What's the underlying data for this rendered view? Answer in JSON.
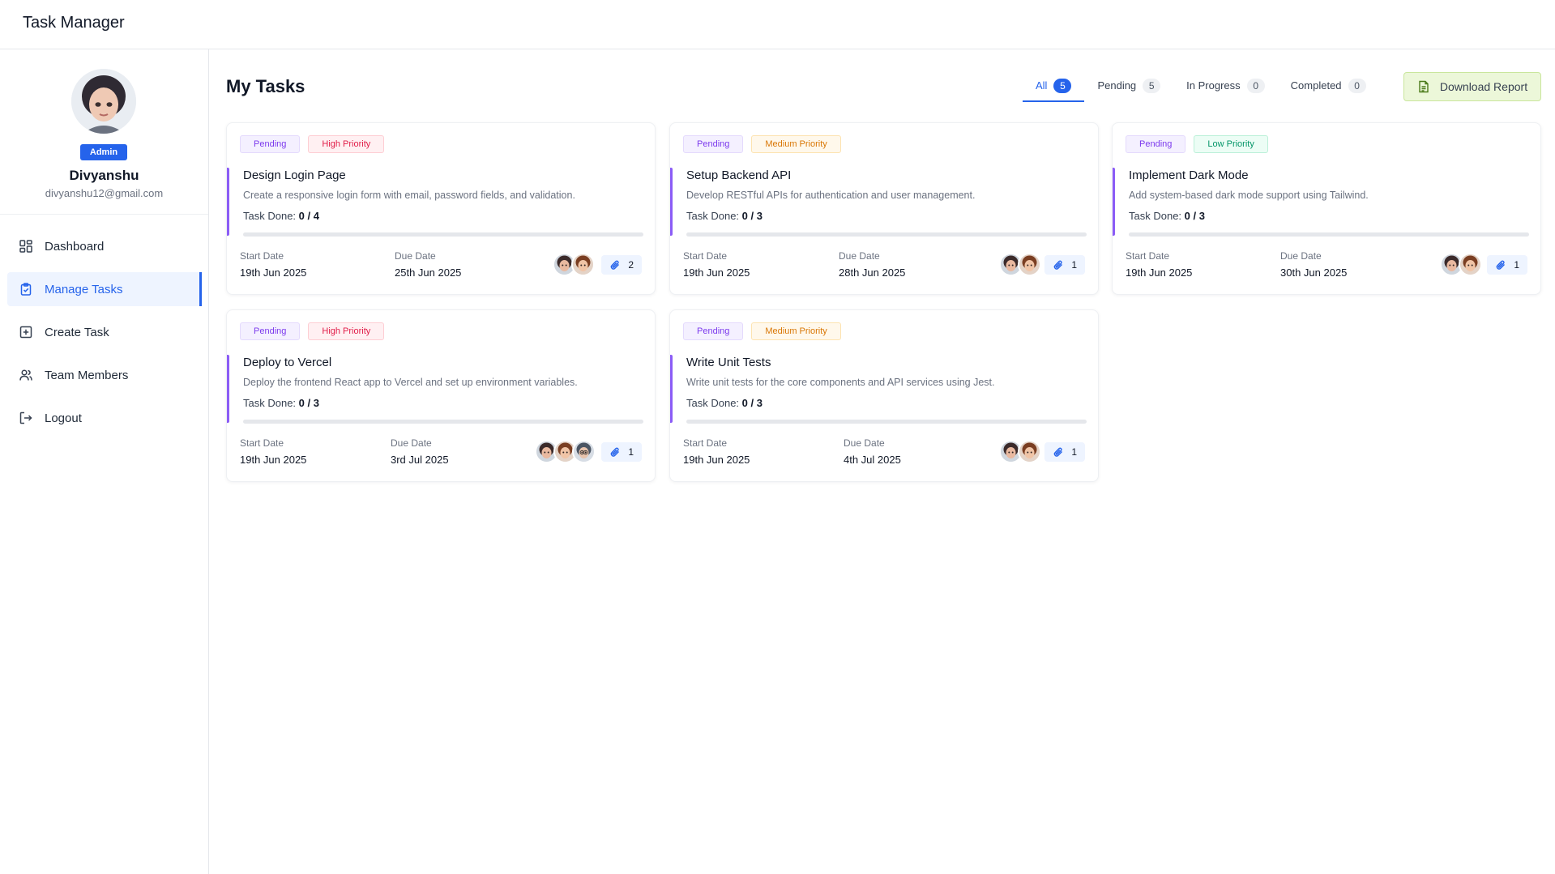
{
  "app": {
    "title": "Task Manager"
  },
  "user": {
    "name": "Divyanshu",
    "email": "divyanshu12@gmail.com",
    "role": "Admin"
  },
  "nav": [
    {
      "label": "Dashboard",
      "icon": "dashboard-icon",
      "active": false
    },
    {
      "label": "Manage Tasks",
      "icon": "clipboard-check-icon",
      "active": true
    },
    {
      "label": "Create Task",
      "icon": "plus-square-icon",
      "active": false
    },
    {
      "label": "Team Members",
      "icon": "users-icon",
      "active": false
    },
    {
      "label": "Logout",
      "icon": "logout-icon",
      "active": false
    }
  ],
  "main": {
    "title": "My Tasks",
    "tabs": [
      {
        "label": "All",
        "count": "5",
        "active": true
      },
      {
        "label": "Pending",
        "count": "5",
        "active": false
      },
      {
        "label": "In Progress",
        "count": "0",
        "active": false
      },
      {
        "label": "Completed",
        "count": "0",
        "active": false
      }
    ],
    "download_label": "Download Report"
  },
  "labels": {
    "task_done": "Task Done:",
    "start_date": "Start Date",
    "due_date": "Due Date"
  },
  "colors": {
    "accent": "#2563eb",
    "task_accent": "#8b5cf6",
    "download_bg": "#ecf7d9"
  },
  "tasks": [
    {
      "status": "Pending",
      "priority": "High Priority",
      "title": "Design Login Page",
      "description": "Create a responsive login form with email, password fields, and validation.",
      "done": "0 / 4",
      "progress": 0,
      "start": "19th Jun 2025",
      "due": "25th Jun 2025",
      "avatars": 2,
      "attachments": "2"
    },
    {
      "status": "Pending",
      "priority": "Medium Priority",
      "title": "Setup Backend API",
      "description": "Develop RESTful APIs for authentication and user management.",
      "done": "0 / 3",
      "progress": 0,
      "start": "19th Jun 2025",
      "due": "28th Jun 2025",
      "avatars": 2,
      "attachments": "1"
    },
    {
      "status": "Pending",
      "priority": "Low Priority",
      "title": "Implement Dark Mode",
      "description": "Add system-based dark mode support using Tailwind.",
      "done": "0 / 3",
      "progress": 0,
      "start": "19th Jun 2025",
      "due": "30th Jun 2025",
      "avatars": 2,
      "attachments": "1"
    },
    {
      "status": "Pending",
      "priority": "High Priority",
      "title": "Deploy to Vercel",
      "description": "Deploy the frontend React app to Vercel and set up environment variables.",
      "done": "0 / 3",
      "progress": 0,
      "start": "19th Jun 2025",
      "due": "3rd Jul 2025",
      "avatars": 3,
      "attachments": "1"
    },
    {
      "status": "Pending",
      "priority": "Medium Priority",
      "title": "Write Unit Tests",
      "description": "Write unit tests for the core components and API services using Jest.",
      "done": "0 / 3",
      "progress": 0,
      "start": "19th Jun 2025",
      "due": "4th Jul 2025",
      "avatars": 2,
      "attachments": "1"
    }
  ]
}
